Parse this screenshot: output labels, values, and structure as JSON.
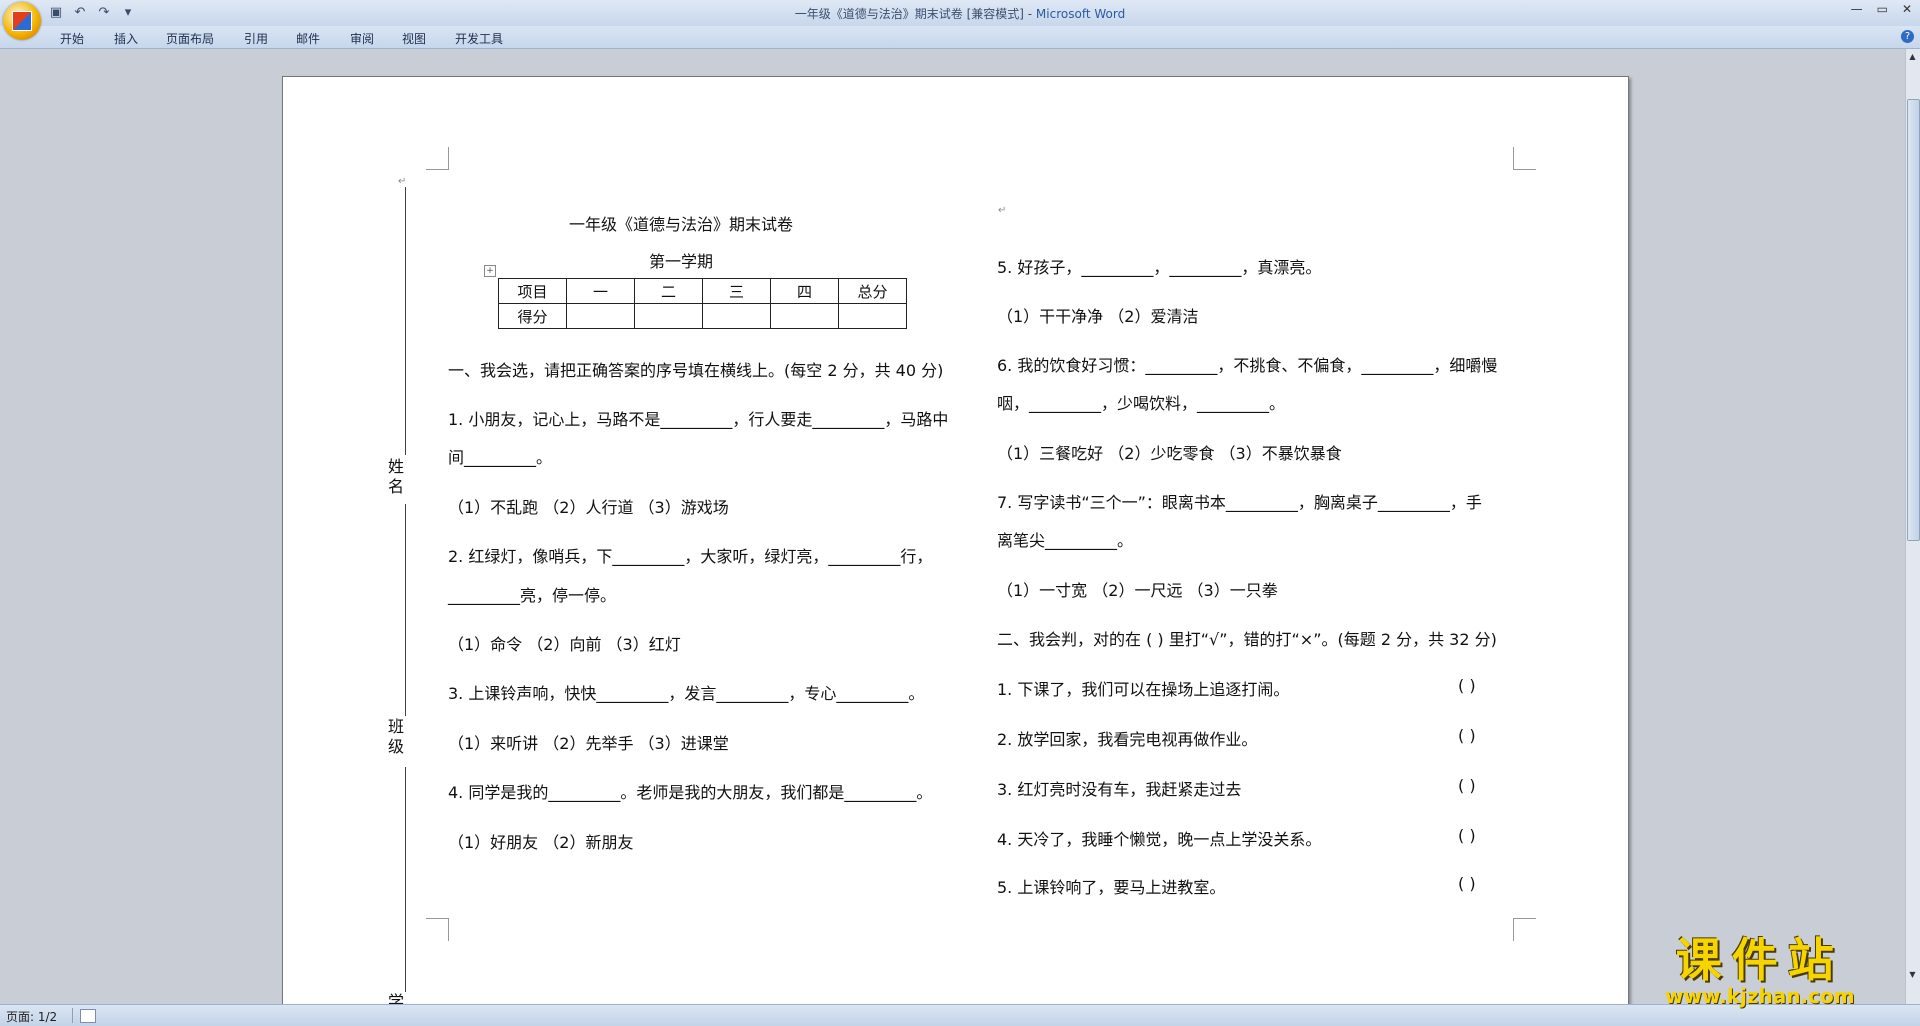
{
  "window": {
    "title": "一年级《道德与法治》期末试卷 [兼容模式] - ",
    "app_name": "Microsoft Word"
  },
  "ribbon_tabs": [
    "开始",
    "插入",
    "页面布局",
    "引用",
    "邮件",
    "审阅",
    "视图",
    "开发工具"
  ],
  "document": {
    "title": "一年级《道德与法治》期末试卷",
    "subtitle": "第一学期",
    "score_table": {
      "header": [
        "项目",
        "一",
        "二",
        "三",
        "四",
        "总分"
      ],
      "row_label": "得分"
    },
    "binding_labels": [
      "姓名",
      "班级",
      "学校"
    ],
    "left_column": [
      "一、我会选，请把正确答案的序号填在横线上。(每空 2 分，共 40 分)",
      "1. 小朋友，记心上，马路不是_________，行人要走_________，马路中",
      "间_________。",
      "（1）不乱跑          （2）人行道          （3）游戏场",
      "2. 红绿灯，像哨兵，下_________，大家听，绿灯亮，_________行，",
      "_________亮，停一停。",
      "（1）命令              （2）向前              （3）红灯",
      "3. 上课铃声响，快快_________，发言_________，专心_________。",
      "（1）来听讲          （2）先举手          （3）进课堂",
      "4. 同学是我的_________。老师是我的大朋友，我们都是_________。",
      "（1）好朋友          （2）新朋友"
    ],
    "right_column": [
      "5. 好孩子，_________，_________，真漂亮。",
      "（1）干干净净          （2）爱清洁",
      "6. 我的饮食好习惯：_________，不挑食、不偏食，_________，细嚼慢",
      "咽，_________，少喝饮料，_________。",
      "（1）三餐吃好          （2）少吃零食          （3）不暴饮暴食",
      "7. 写字读书“三个一”：眼离书本_________，胸离桌子_________，手",
      "离笔尖_________。",
      "（1）一寸宽              （2）一尺远              （3）一只拳",
      "二、我会判，对的在 ( ) 里打“√”，错的打“×”。(每题 2 分，共 32 分)",
      "1. 下课了，我们可以在操场上追逐打闹。",
      "2. 放学回家，我看完电视再做作业。",
      "3. 红灯亮时没有车，我赶紧走过去",
      "4. 天冷了，我睡个懒觉，晚一点上学没关系。",
      "5. 上课铃响了，要马上进教室。"
    ],
    "judge_paren": "(      )"
  },
  "status_bar": {
    "page_info": "页面: 1/2"
  },
  "watermark": {
    "brand": "课件站",
    "url": "www.kjzhan.com"
  }
}
